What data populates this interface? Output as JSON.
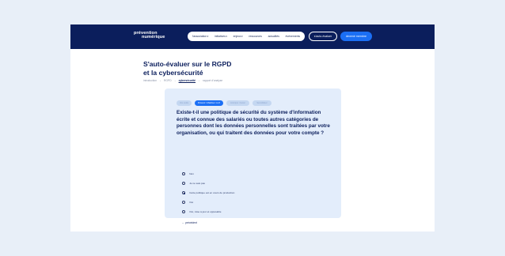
{
  "header": {
    "logo": [
      "prévention",
      "numérique"
    ],
    "nav": [
      {
        "label": "l'association",
        "dropdown": true
      },
      {
        "label": "initiatives",
        "dropdown": true
      },
      {
        "label": "enjeux",
        "dropdown": true
      },
      {
        "label": "ressources",
        "dropdown": false
      },
      {
        "label": "actualités",
        "dropdown": false
      },
      {
        "label": "événements",
        "dropdown": false
      }
    ],
    "self_eval_button": "s'auto-évaluer",
    "member_button": "devenir membre"
  },
  "page": {
    "title_lines": [
      "S'auto-évaluer sur le RGPD",
      "et la cybersécurité"
    ],
    "steps": [
      {
        "label": "introduction",
        "active": false
      },
      {
        "label": "RGPD",
        "active": false
      },
      {
        "label": "cybersécurité",
        "active": true
      },
      {
        "label": "rapport d'analyse",
        "active": false
      }
    ]
  },
  "card": {
    "tabs": [
      {
        "label": "Vos outils",
        "active": false
      },
      {
        "label": "Prévenir / Maitriser 1 à 6",
        "active": true
      },
      {
        "label": "Anticiper / Gérer",
        "active": false
      },
      {
        "label": "Sensibiliser",
        "active": false
      }
    ],
    "question": "Existe-t-il une politique de sécurité du système d'information écrite et connue des salariés ou toutes autres catégories de personnes dont les données personnelles sont traitées par votre organisation, ou qui traitent des données pour votre compte ?",
    "options": [
      {
        "label": "Non",
        "checked": false
      },
      {
        "label": "Je ne sais pas",
        "checked": false
      },
      {
        "label": "Cette politique est en cours de production",
        "checked": true
      },
      {
        "label": "Oui",
        "checked": false
      },
      {
        "label": "Oui, mise à jour et opposable",
        "checked": false
      }
    ],
    "previous": "← précédent"
  },
  "colors": {
    "navy": "#0b1e5c",
    "accent": "#1b6ff5",
    "background": "#e8eff8",
    "card": "#e3edfb"
  }
}
